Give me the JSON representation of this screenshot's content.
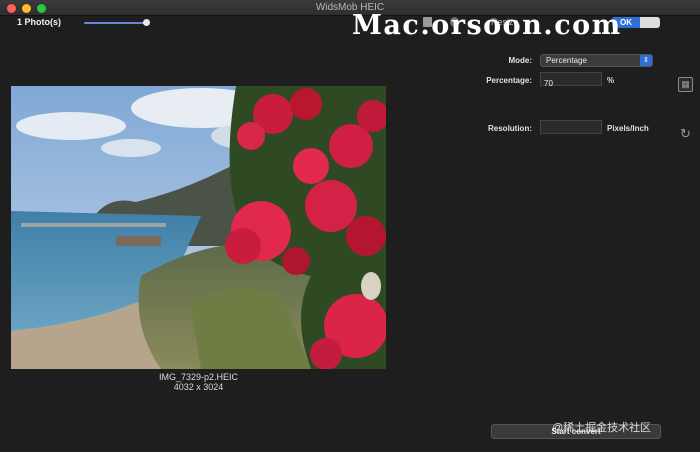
{
  "window": {
    "title": "WidsMob HEIC"
  },
  "toolbar": {
    "photo_count": "1 Photo(s)",
    "zoom_fraction": 0.95,
    "resize_label": "Resize",
    "ok_label": "OK"
  },
  "watermark": {
    "text": "Mac.orsoon.com"
  },
  "photo": {
    "filename": "IMG_7329-p2.HEIC",
    "dimensions": "4032 x 3024"
  },
  "settings": {
    "mode_label": "Mode:",
    "mode_value": "Percentage",
    "percentage_label": "Percentage:",
    "percentage_value": "70",
    "percentage_unit": "%",
    "resolution_label": "Resolution:",
    "resolution_value": "",
    "resolution_unit": "Pixels/Inch"
  },
  "actions": {
    "start_convert": "Start convert"
  },
  "corner_watermark": "@稀土掘金技术社区",
  "colors": {
    "background": "#1e1e1e",
    "accent": "#2f6fd6",
    "close": "#fe5f57",
    "minimize": "#febc2e",
    "maximize": "#28c840"
  }
}
